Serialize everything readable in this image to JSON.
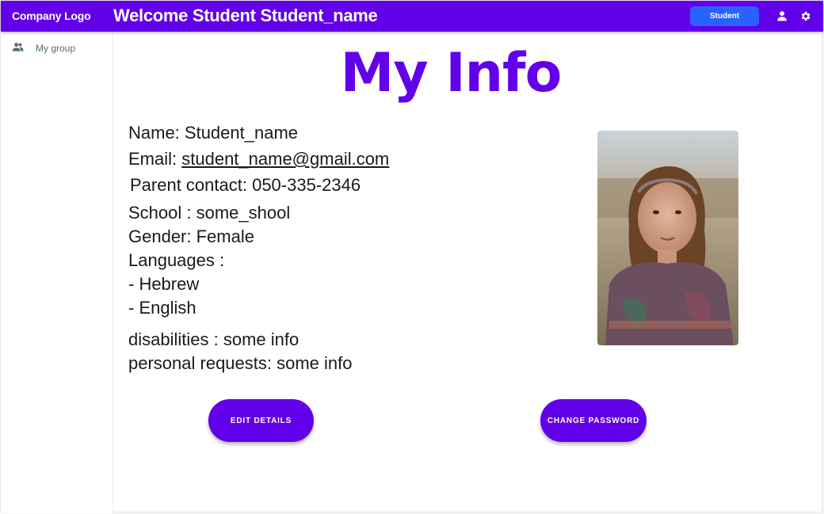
{
  "header": {
    "logo": "Company Logo",
    "welcome": "Welcome Student Student_name",
    "role_button": "Student",
    "icons": [
      "user-icon",
      "gear-icon"
    ],
    "color": "#6200ea",
    "role_color": "#2962ff"
  },
  "sidebar": {
    "items": [
      {
        "label": "My group",
        "icon": "group-icon"
      }
    ]
  },
  "main": {
    "title": "My Info",
    "info": {
      "name": "Name: Student_name",
      "email_label": "Email: ",
      "email": "student_name@gmail.com",
      "parent_contact": "Parent contact: 050-335-2346",
      "school": "School : some_shool",
      "gender": "Gender: Female",
      "languages_label": "Languages :",
      "languages": [
        "- Hebrew",
        "- English"
      ],
      "disabilities": "disabilities : some info",
      "personal_requests": "personal requests: some info"
    },
    "buttons": {
      "edit": "EDIT DETAILS",
      "change_password": "CHANGE PASSWORD"
    }
  }
}
